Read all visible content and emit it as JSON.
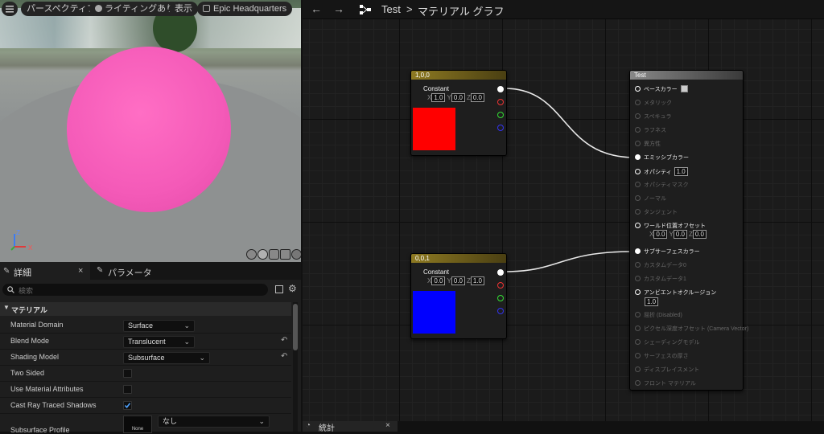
{
  "viewport": {
    "menu_icon": "hamburger-icon",
    "perspective_label": "パースペクティブ",
    "lighting_label": "ライティングあり",
    "show_label": "表示",
    "headquarters_label": "Epic Headquarters",
    "axis_labels": {
      "z": "Z",
      "x": "X"
    },
    "sphere_color": "#f45ab8"
  },
  "graph": {
    "breadcrumb_root": "Test",
    "breadcrumb_sep": ">",
    "breadcrumb_current": "マテリアル グラフ",
    "nodes": {
      "red": {
        "title": "1,0,0",
        "label": "Constant",
        "x": "1.0",
        "y": "0.0",
        "z": "0.0",
        "swatch": "#ff0000",
        "header_color": "#7a6a1e"
      },
      "blue": {
        "title": "0,0,1",
        "label": "Constant",
        "x": "0.0",
        "y": "0.0",
        "z": "1.0",
        "swatch": "#0000ff",
        "header_color": "#7a6a1e"
      },
      "material": {
        "title": "Test",
        "header_color": "#7a7a7a"
      }
    },
    "material_pins": [
      {
        "label": "ベースカラー",
        "active": true
      },
      {
        "label": "メタリック",
        "active": false
      },
      {
        "label": "スペキュラ",
        "active": false
      },
      {
        "label": "ラフネス",
        "active": false
      },
      {
        "label": "異方性",
        "active": false
      },
      {
        "label": "エミッシブカラー",
        "active": true
      },
      {
        "label": "オパシティ",
        "active": true,
        "value": "1.0"
      },
      {
        "label": "オパシティマスク",
        "active": false
      },
      {
        "label": "ノーマル",
        "active": false
      },
      {
        "label": "タンジェント",
        "active": false
      },
      {
        "label": "ワールド位置オフセット",
        "active": true
      },
      {
        "label": "サブサーフェスカラー",
        "active": true
      },
      {
        "label": "カスタムデータ0",
        "active": false
      },
      {
        "label": "カスタムデータ1",
        "active": false
      },
      {
        "label": "アンビエントオクルージョン",
        "active": true,
        "value": "1.0"
      },
      {
        "label": "屈折 (Disabled)",
        "active": false
      },
      {
        "label": "ピクセル深度オフセット (Camera Vector)",
        "active": false
      },
      {
        "label": "シェーディングモデル",
        "active": false
      },
      {
        "label": "サーフェスの厚さ",
        "active": false
      },
      {
        "label": "ディスプレイスメント",
        "active": false
      },
      {
        "label": "フロント マテリアル",
        "active": false
      }
    ],
    "wpo": {
      "x": "0.0",
      "y": "0.0",
      "z": "0.0"
    },
    "stats_tab": "統計",
    "stats_close": "×"
  },
  "details": {
    "tab_details": "詳細",
    "tab_details_close": "×",
    "tab_params": "パラメータ",
    "search_placeholder": "検索",
    "section": "マテリアル",
    "rows": {
      "domain": {
        "label": "Material Domain",
        "value": "Surface"
      },
      "blend": {
        "label": "Blend Mode",
        "value": "Translucent"
      },
      "shading": {
        "label": "Shading Model",
        "value": "Subsurface"
      },
      "two_sided": {
        "label": "Two Sided",
        "checked": false
      },
      "use_attr": {
        "label": "Use Material Attributes",
        "checked": false
      },
      "cast_ray": {
        "label": "Cast Ray Traced Shadows",
        "checked": true
      },
      "profile": {
        "label": "Subsurface Profile",
        "value": "なし",
        "thumb": "None"
      }
    }
  }
}
